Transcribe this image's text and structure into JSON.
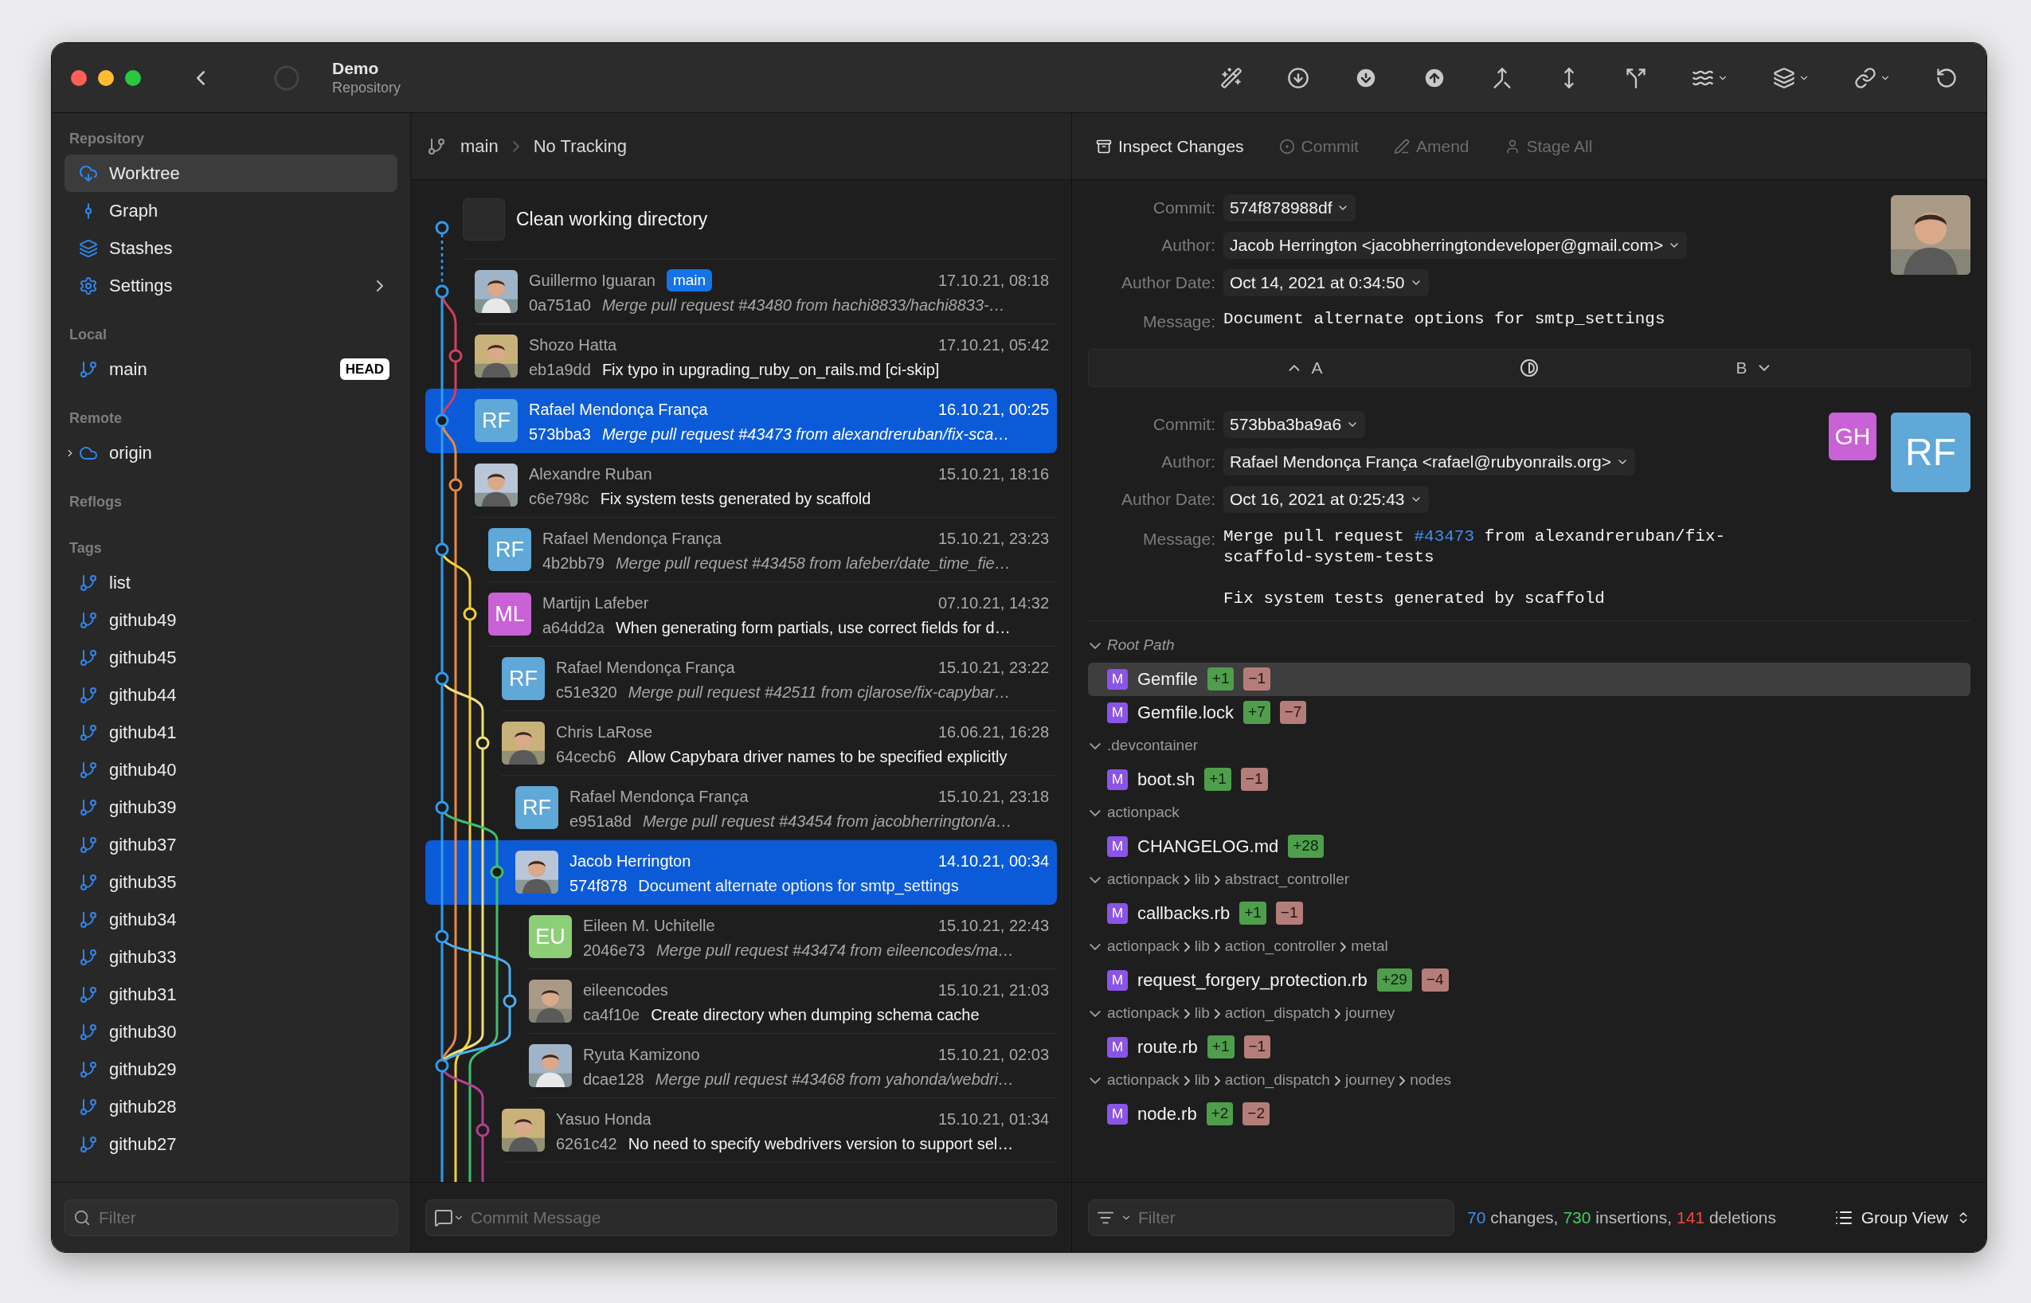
{
  "window": {
    "title": "Demo",
    "subtitle": "Repository"
  },
  "sidebar": {
    "sections": [
      {
        "title": "Repository",
        "items": [
          {
            "kind": "worktree",
            "label": "Worktree",
            "selected": true
          },
          {
            "kind": "graph",
            "label": "Graph",
            "selected": false
          },
          {
            "kind": "stashes",
            "label": "Stashes",
            "selected": false
          },
          {
            "kind": "settings",
            "label": "Settings",
            "selected": false
          }
        ]
      },
      {
        "title": "Local",
        "items": [
          {
            "kind": "branch",
            "label": "main",
            "badge": "HEAD"
          }
        ]
      },
      {
        "title": "Remote",
        "items": [
          {
            "kind": "remote",
            "label": "origin",
            "expanded": false
          }
        ]
      },
      {
        "title": "Reflogs"
      },
      {
        "title": "Tags",
        "items": [
          {
            "kind": "tag",
            "label": "list"
          },
          {
            "kind": "tag",
            "label": "github49"
          },
          {
            "kind": "tag",
            "label": "github45"
          },
          {
            "kind": "tag",
            "label": "github44"
          },
          {
            "kind": "tag",
            "label": "github41"
          },
          {
            "kind": "tag",
            "label": "github40"
          },
          {
            "kind": "tag",
            "label": "github39"
          },
          {
            "kind": "tag",
            "label": "github37"
          },
          {
            "kind": "tag",
            "label": "github35"
          },
          {
            "kind": "tag",
            "label": "github34"
          },
          {
            "kind": "tag",
            "label": "github33"
          },
          {
            "kind": "tag",
            "label": "github31"
          },
          {
            "kind": "tag",
            "label": "github30"
          },
          {
            "kind": "tag",
            "label": "github29"
          },
          {
            "kind": "tag",
            "label": "github28"
          },
          {
            "kind": "tag",
            "label": "github27"
          }
        ]
      }
    ],
    "filter": {
      "placeholder": "Filter"
    }
  },
  "history": {
    "branch": "main",
    "tracking": "No Tracking",
    "clean": "Clean working directory",
    "commits": [
      {
        "author": "Guillermo Iguaran",
        "tag": "main",
        "date": "17.10.21, 08:18",
        "hash": "0a751a0",
        "message": "Merge pull request #43480 from hachi8833/hachi8833-…",
        "kind": "merge",
        "selected": false
      },
      {
        "author": "Shozo Hatta",
        "date": "17.10.21, 05:42",
        "hash": "eb1a9dd",
        "message": "Fix typo in upgrading_ruby_on_rails.md [ci-skip]",
        "kind": "commit",
        "selected": false
      },
      {
        "author": "Rafael Mendonça França",
        "date": "16.10.21, 00:25",
        "hash": "573bba3",
        "message": "Merge pull request #43473 from alexandreruban/fix-sca…",
        "kind": "merge",
        "selected": true,
        "avatar": {
          "kind": "initials",
          "initials": "RF",
          "color": "#5fa8d8"
        }
      },
      {
        "author": "Alexandre Ruban",
        "date": "15.10.21, 18:16",
        "hash": "c6e798c",
        "message": "Fix system tests generated by scaffold",
        "kind": "commit",
        "selected": false
      },
      {
        "author": "Rafael Mendonça França",
        "date": "15.10.21, 23:23",
        "hash": "4b2bb79",
        "message": "Merge pull request #43458 from lafeber/date_time_fie…",
        "kind": "merge",
        "selected": false,
        "avatar": {
          "kind": "initials",
          "initials": "RF",
          "color": "#5fa8d8"
        }
      },
      {
        "author": "Martijn Lafeber",
        "date": "07.10.21, 14:32",
        "hash": "a64dd2a",
        "message": "When generating form partials, use correct fields for d…",
        "kind": "commit",
        "selected": false,
        "avatar": {
          "kind": "initials",
          "initials": "ML",
          "color": "#c862d6"
        }
      },
      {
        "author": "Rafael Mendonça França",
        "date": "15.10.21, 23:22",
        "hash": "c51e320",
        "message": "Merge pull request #42511 from cjlarose/fix-capybar…",
        "kind": "merge",
        "selected": false,
        "avatar": {
          "kind": "initials",
          "initials": "RF",
          "color": "#5fa8d8"
        }
      },
      {
        "author": "Chris LaRose",
        "date": "16.06.21, 16:28",
        "hash": "64cecb6",
        "message": "Allow Capybara driver names to be specified explicitly",
        "kind": "commit",
        "selected": false
      },
      {
        "author": "Rafael Mendonça França",
        "date": "15.10.21, 23:18",
        "hash": "e951a8d",
        "message": "Merge pull request #43454 from jacobherrington/a…",
        "kind": "merge",
        "selected": false,
        "avatar": {
          "kind": "initials",
          "initials": "RF",
          "color": "#5fa8d8"
        }
      },
      {
        "author": "Jacob Herrington",
        "date": "14.10.21, 00:34",
        "hash": "574f878",
        "message": "Document alternate options for smtp_settings",
        "kind": "commit",
        "selected": true
      },
      {
        "author": "Eileen M. Uchitelle",
        "date": "15.10.21, 22:43",
        "hash": "2046e73",
        "message": "Merge pull request #43474 from eileencodes/ma…",
        "kind": "merge",
        "selected": false,
        "avatar": {
          "kind": "initials",
          "initials": "EU",
          "color": "#8dcf78"
        }
      },
      {
        "author": "eileencodes",
        "date": "15.10.21, 21:03",
        "hash": "ca4f10e",
        "message": "Create directory when dumping schema cache",
        "kind": "commit",
        "selected": false
      },
      {
        "author": "Ryuta Kamizono",
        "date": "15.10.21, 02:03",
        "hash": "dcae128",
        "message": "Merge pull request #43468 from yahonda/webdri…",
        "kind": "merge",
        "selected": false
      },
      {
        "author": "Yasuo Honda",
        "date": "15.10.21, 01:34",
        "hash": "6261c42",
        "message": "No need to specify webdrivers version to support sel…",
        "kind": "commit",
        "selected": false
      }
    ],
    "commit_message": {
      "placeholder": "Commit Message"
    }
  },
  "inspector": {
    "actions": [
      {
        "kind": "inspect",
        "label": "Inspect Changes",
        "disabled": false
      },
      {
        "kind": "commit",
        "label": "Commit",
        "disabled": true
      },
      {
        "kind": "amend",
        "label": "Amend",
        "disabled": true
      },
      {
        "kind": "stage",
        "label": "Stage All",
        "disabled": true
      }
    ],
    "details": [
      {
        "labels": {
          "commit": "Commit:",
          "author": "Author:",
          "date": "Author Date:",
          "message": "Message:"
        },
        "commit": "574f878988df",
        "author": "Jacob Herrington <jacobherringtondeveloper@gmail.com>",
        "date": "Oct 14, 2021 at 0:34:50",
        "message": {
          "before": "Document alternate options for smtp_settings"
        }
      },
      {
        "labels": {
          "commit": "Commit:",
          "author": "Author:",
          "date": "Author Date:",
          "message": "Message:"
        },
        "commit": "573bba3ba9a6",
        "author": "Rafael Mendonça França <rafael@rubyonrails.org>",
        "date": "Oct 16, 2021 at 0:25:43",
        "message": {
          "before": "Merge pull request ",
          "link": "#43473",
          "after": " from alexandreruban/fix-scaffold-system-tests",
          "body": "Fix system tests generated by scaffold"
        },
        "avatars": [
          {
            "kind": "initials",
            "initials": "GH",
            "color": "#c862d6"
          },
          {
            "kind": "initials",
            "initials": "RF",
            "color": "#5fa8d8"
          }
        ]
      }
    ],
    "compare": {
      "a": "A",
      "b": "B"
    },
    "groups": [
      {
        "kind": "root",
        "path": [
          "Root Path"
        ],
        "expanded": true,
        "files": [
          {
            "status": "M",
            "name": "Gemfile",
            "added": "+1",
            "removed": "−1",
            "selected": true
          },
          {
            "status": "M",
            "name": "Gemfile.lock",
            "added": "+7",
            "removed": "−7",
            "selected": false
          }
        ]
      },
      {
        "kind": "folder",
        "path": [
          ".devcontainer"
        ],
        "expanded": true,
        "files": [
          {
            "status": "M",
            "name": "boot.sh",
            "added": "+1",
            "removed": "−1",
            "selected": false
          }
        ]
      },
      {
        "kind": "folder",
        "path": [
          "actionpack"
        ],
        "expanded": true,
        "files": [
          {
            "status": "M",
            "name": "CHANGELOG.md",
            "added": "+28",
            "selected": false
          }
        ]
      },
      {
        "kind": "folder",
        "path": [
          "actionpack",
          "lib",
          "abstract_controller"
        ],
        "expanded": true,
        "files": [
          {
            "status": "M",
            "name": "callbacks.rb",
            "added": "+1",
            "removed": "−1",
            "selected": false
          }
        ]
      },
      {
        "kind": "folder",
        "path": [
          "actionpack",
          "lib",
          "action_controller",
          "metal"
        ],
        "expanded": true,
        "files": [
          {
            "status": "M",
            "name": "request_forgery_protection.rb",
            "added": "+29",
            "removed": "−4",
            "selected": false
          }
        ]
      },
      {
        "kind": "folder",
        "path": [
          "actionpack",
          "lib",
          "action_dispatch",
          "journey"
        ],
        "expanded": true,
        "files": [
          {
            "status": "M",
            "name": "route.rb",
            "added": "+1",
            "removed": "−1",
            "selected": false
          }
        ]
      },
      {
        "kind": "folder",
        "path": [
          "actionpack",
          "lib",
          "action_dispatch",
          "journey",
          "nodes"
        ],
        "expanded": true,
        "files": [
          {
            "status": "M",
            "name": "node.rb",
            "added": "+2",
            "removed": "−2",
            "selected": false
          }
        ]
      }
    ],
    "filter": {
      "placeholder": "Filter"
    },
    "stats": [
      {
        "kind": "changes",
        "count": "70",
        "word": "changes,"
      },
      {
        "kind": "insertions",
        "count": "730",
        "word": "insertions,"
      },
      {
        "kind": "deletions",
        "count": "141",
        "word": "deletions"
      }
    ],
    "view": "Group View"
  }
}
